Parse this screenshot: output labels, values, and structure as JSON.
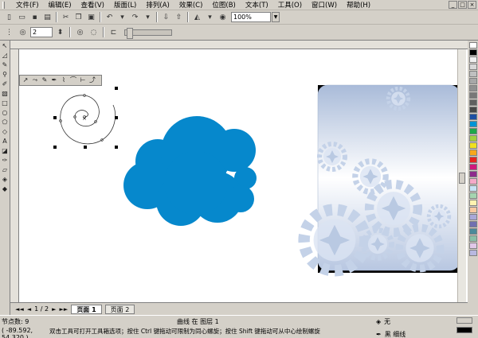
{
  "menubar": {
    "items": [
      "文件(F)",
      "编辑(E)",
      "查看(V)",
      "版面(L)",
      "排列(A)",
      "效果(C)",
      "位图(B)",
      "文本(T)",
      "工具(O)",
      "窗口(W)",
      "帮助(H)"
    ],
    "window_buttons": [
      "_",
      "□",
      "×"
    ]
  },
  "toolbar": {
    "zoom": "100%"
  },
  "property_bar": {
    "spiral_revolutions": "2"
  },
  "pages": {
    "counter": "1 / 2",
    "tabs": [
      "页面 1",
      "页面 2"
    ]
  },
  "status": {
    "nodes": "节点数: 9",
    "object_info": "曲线 在 图层 1",
    "coordinates": "( -89.592, 54.320 )",
    "hint": "双击工具可打开工具箱选项；按住 Ctrl 键拖动可限制为同心螺旋；按住 Shift 键拖动可从中心绘制螺旋",
    "fill_label": "无",
    "outline_label": "黑 细线"
  },
  "colors": {
    "cloud": "#0688cc",
    "chrome": "#d4d0c8",
    "gradient_top": "#a9bbd9",
    "gradient_mid": "#ffffff",
    "gradient_bottom": "#b8c7e1"
  },
  "palette_colors": [
    "#ffffff",
    "#000000",
    "#f0f0f0",
    "#d8d8d8",
    "#c0c0c0",
    "#a8a8a8",
    "#909090",
    "#787878",
    "#606060",
    "#484848",
    "#1e4fa3",
    "#0094d6",
    "#1ea84a",
    "#a0d040",
    "#f0e020",
    "#f7a81c",
    "#e6261f",
    "#d0187c",
    "#8e2b8c",
    "#f5a9c8",
    "#c7e3f5",
    "#a4d4b0",
    "#fff3b0",
    "#f8c9a0",
    "#a8a8d8",
    "#7070b0",
    "#4a8a9a",
    "#8ac0a8",
    "#e0c8e8",
    "#b8b8e0"
  ]
}
